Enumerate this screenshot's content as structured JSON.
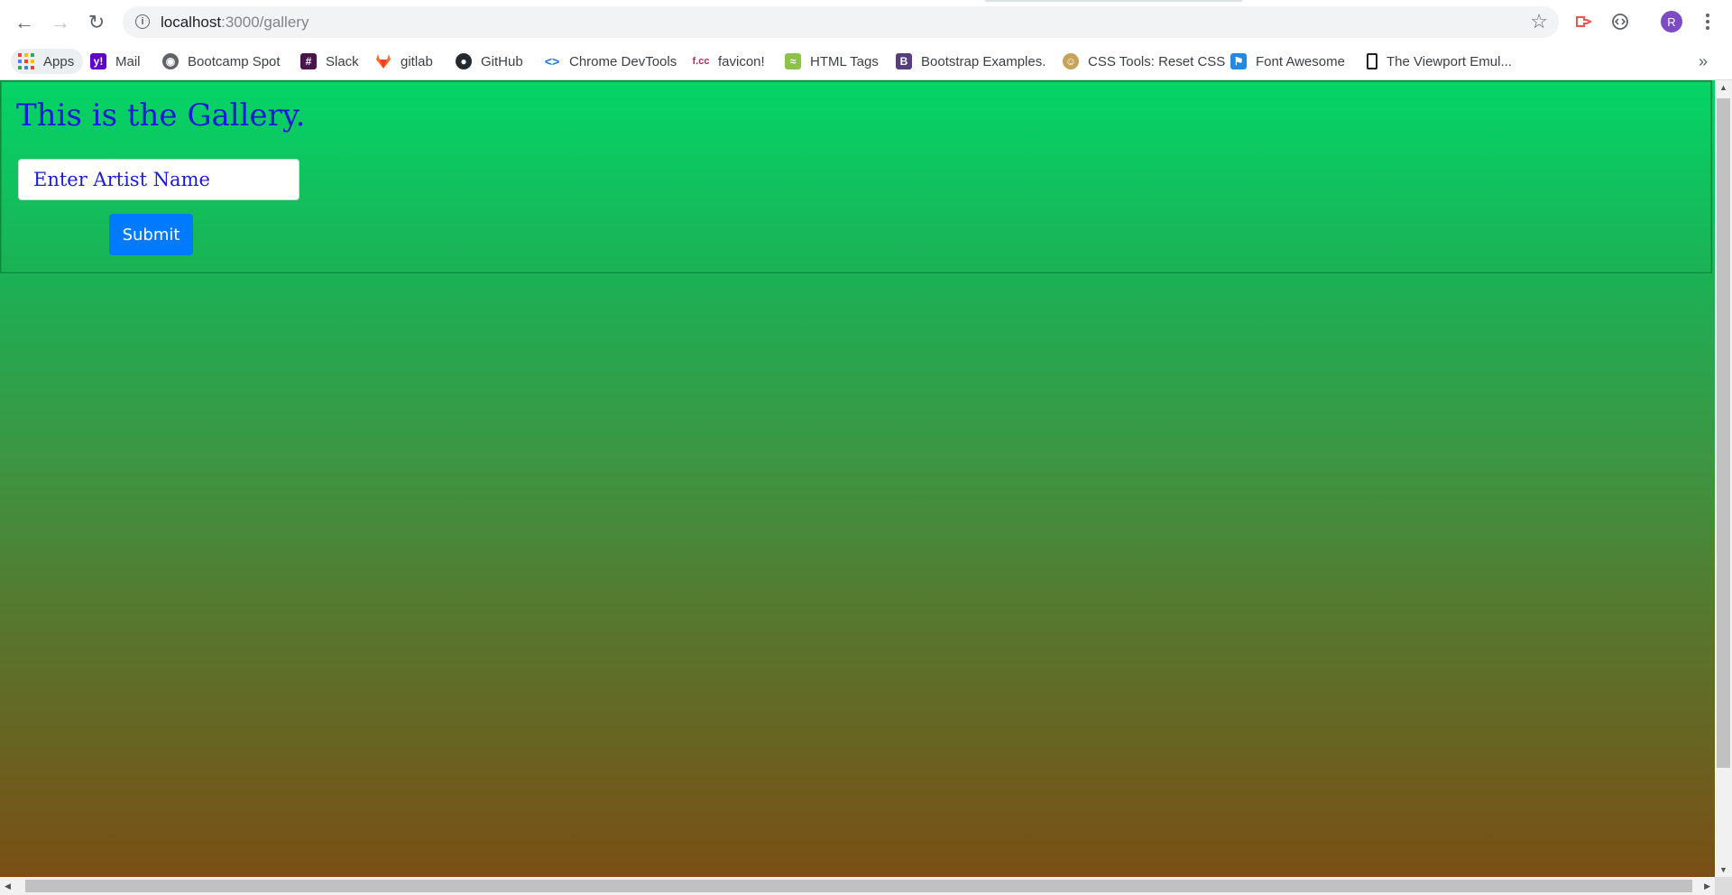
{
  "browser": {
    "url_host": "localhost",
    "url_path": ":3000/gallery",
    "avatar_initial": "R",
    "bookmarks": [
      {
        "label": "Apps",
        "icon": "apps-grid-icon"
      },
      {
        "label": "Mail",
        "icon": "yahoo-icon"
      },
      {
        "label": "Bootcamp Spot",
        "icon": "globe-icon"
      },
      {
        "label": "Slack",
        "icon": "slack-icon"
      },
      {
        "label": "gitlab",
        "icon": "gitlab-icon"
      },
      {
        "label": "GitHub",
        "icon": "github-icon"
      },
      {
        "label": "Chrome DevTools",
        "icon": "devtools-icon"
      },
      {
        "label": "favicon!",
        "icon": "fcc-icon"
      },
      {
        "label": "HTML Tags",
        "icon": "html-tags-icon"
      },
      {
        "label": "Bootstrap Examples.",
        "icon": "bootstrap-icon"
      },
      {
        "label": "CSS Tools: Reset CSS",
        "icon": "css-tools-icon"
      },
      {
        "label": "Font Awesome",
        "icon": "flag-icon"
      },
      {
        "label": "The Viewport Emul...",
        "icon": "phone-icon"
      }
    ],
    "more_bookmarks": "»"
  },
  "page": {
    "title": "This is the Gallery.",
    "input_placeholder": "Enter Artist Name",
    "submit_label": "Submit"
  },
  "colors": {
    "gradient_top": "#04d566",
    "gradient_bottom": "#7a4f15",
    "title_text": "#1a1adc",
    "submit_button": "#007bff"
  }
}
